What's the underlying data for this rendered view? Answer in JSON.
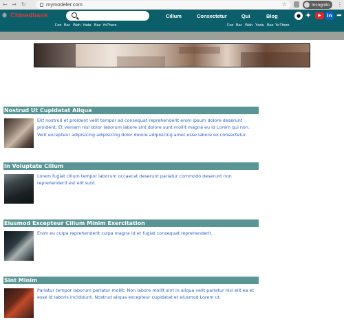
{
  "browser": {
    "url": "mymodeler.com",
    "incognito_label": "Incognito"
  },
  "site": {
    "brand": "Chinedbank",
    "search": {
      "placeholder": ""
    },
    "nav": [
      "Cillum",
      "Consectetur",
      "Qui",
      "Blog"
    ],
    "subnav_left": [
      "Foo",
      "Bar",
      "Wah",
      "Yada",
      "Baz",
      "YoThere"
    ],
    "subnav_right": [
      "Foo",
      "Bar",
      "Wah",
      "Yada",
      "Baz",
      "YoThere"
    ],
    "social": [
      "github-icon",
      "twitter-icon",
      "youtube-icon",
      "linkedin-icon",
      "share-icon"
    ],
    "colors": {
      "header": "#0b5f6b",
      "brand": "#e23a3a",
      "section_heading": "#5a9595",
      "body_text": "#2a62c2"
    }
  },
  "articles": [
    {
      "title": "Nostrud Ut Cupidatat Aliqua",
      "text": "Elit nostrud et proident velit tempor ad consequat reprehenderit enim ipsum dolore deserunt proident. Et veniam nisi dolor laborum labore sint dolore sunt mollit magna eu id Lorem qui non. Velit excepteur adipisicing adipisicing dolor dolore adipisicing amet esse labore ex consectetur."
    },
    {
      "title": "In Voluptate Cillum",
      "text": "Lorem fugiat cillum tempor laborum occaecat deserunt pariatur commodo deserunt non reprehenderit est elit sunt."
    },
    {
      "title": "Eiusmod Excepteur Cillum Minim Exercitation",
      "text": "Enim eu culpa reprehenderit culpa magna id et fugiat consequat reprehenderit."
    },
    {
      "title": "Sint Minim",
      "text": "Pariatur tempor laborum pariatur mollit. Non labore mollit sint in aliqua velit pariatur nisi elit ea et esse id laboris incididunt. Nostrud aliqua excepteur cupidatat et eiusmod Lorem ut."
    }
  ]
}
